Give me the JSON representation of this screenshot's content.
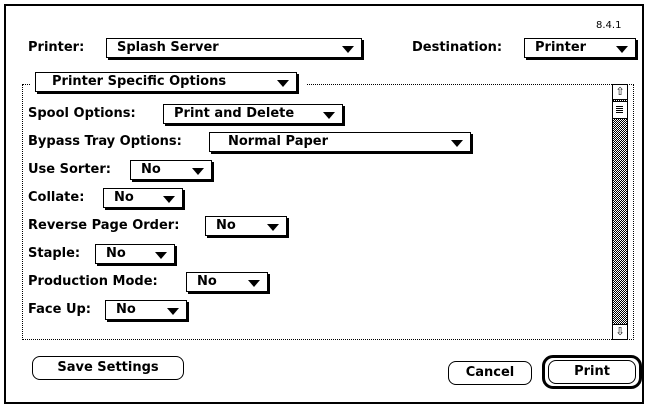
{
  "version": "8.4.1",
  "printer": {
    "label": "Printer:",
    "value": "Splash Server"
  },
  "destination": {
    "label": "Destination:",
    "value": "Printer"
  },
  "section": {
    "value": "Printer Specific Options"
  },
  "options": [
    {
      "label": "Spool Options:",
      "value": "Print and Delete"
    },
    {
      "label": "Bypass Tray Options:",
      "value": "Normal Paper"
    },
    {
      "label": "Use Sorter:",
      "value": "No"
    },
    {
      "label": "Collate:",
      "value": "No"
    },
    {
      "label": "Reverse Page Order:",
      "value": "No"
    },
    {
      "label": "Staple:",
      "value": "No"
    },
    {
      "label": "Production Mode:",
      "value": "No"
    },
    {
      "label": "Face Up:",
      "value": "No"
    }
  ],
  "scrollbar": {
    "up_icon": "⇧",
    "down_icon": "⇩"
  },
  "buttons": {
    "save": "Save Settings",
    "cancel": "Cancel",
    "print": "Print"
  }
}
